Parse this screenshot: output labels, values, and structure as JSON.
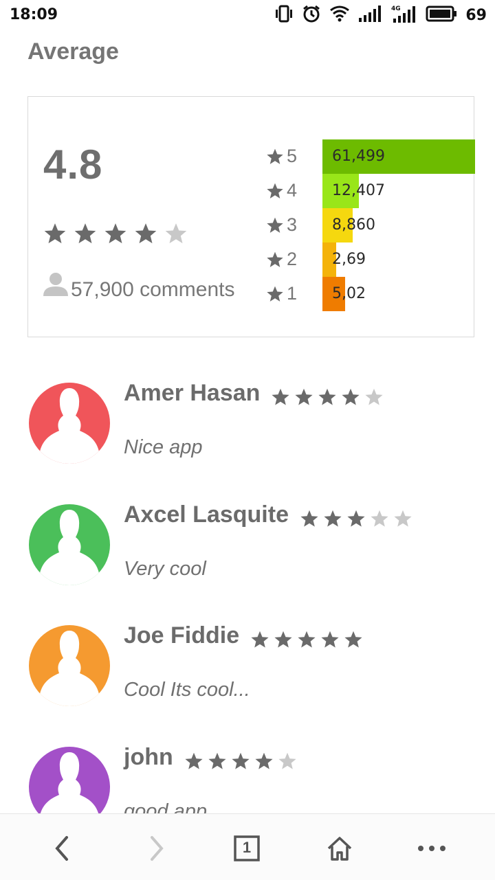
{
  "status_bar": {
    "time": "18:09",
    "battery_level": "69",
    "icons": [
      "vibrate-icon",
      "alarm-icon",
      "wifi-icon",
      "signal-icon",
      "4g-signal-icon",
      "battery-icon"
    ]
  },
  "section": {
    "title": "Average"
  },
  "rating_summary": {
    "average": "4.8",
    "stars_filled": 4,
    "stars_total": 5,
    "comments_label": "57,900 comments",
    "distribution": [
      {
        "star": "5",
        "count": "61,499",
        "color": "#6dbb00",
        "fill_fraction": 1.0
      },
      {
        "star": "4",
        "count": "12,407",
        "color": "#99e619",
        "fill_fraction": 0.24
      },
      {
        "star": "3",
        "count": "8,860",
        "color": "#f5d80f",
        "fill_fraction": 0.2
      },
      {
        "star": "2",
        "count": "2,69",
        "color": "#f4b30a",
        "fill_fraction": 0.09
      },
      {
        "star": "1",
        "count": "5,02",
        "color": "#ef7c00",
        "fill_fraction": 0.15
      }
    ]
  },
  "reviews": [
    {
      "name": "Amer Hasan",
      "rating": 4,
      "text": "Nice app",
      "avatar_color": "#f0555a"
    },
    {
      "name": "Axcel Lasquite",
      "rating": 3,
      "text": "Very cool",
      "avatar_color": "#4bbf5a"
    },
    {
      "name": "Joe Fiddie",
      "rating": 5,
      "text": "Cool Its cool...",
      "avatar_color": "#f59a30"
    },
    {
      "name": "john",
      "rating": 4,
      "text": "good app",
      "avatar_color": "#a350c8"
    }
  ],
  "nav": {
    "tab_count": "1",
    "icons": [
      "back-icon",
      "forward-icon",
      "tabs-icon",
      "home-icon",
      "more-icon"
    ]
  }
}
